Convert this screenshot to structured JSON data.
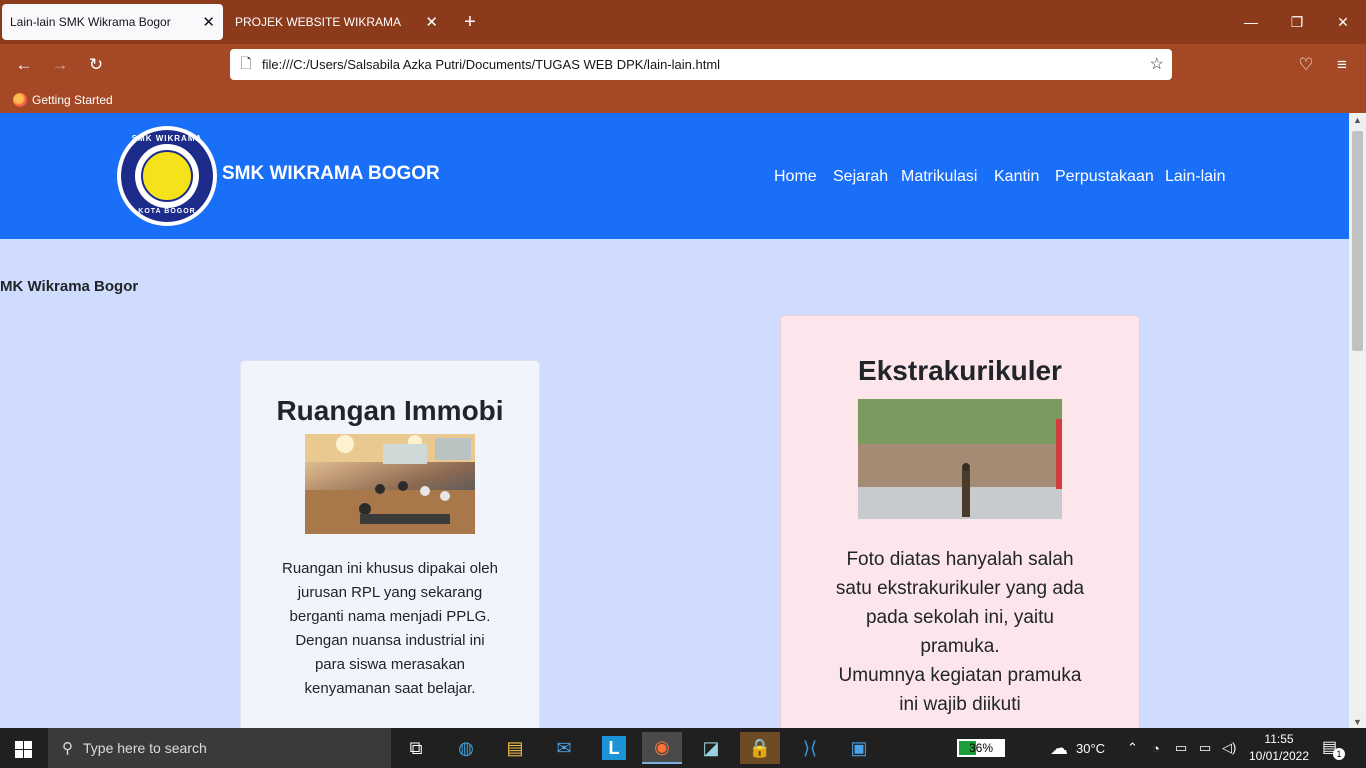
{
  "browser": {
    "tabs": [
      {
        "title": "Lain-lain SMK Wikrama Bogor",
        "active": true
      },
      {
        "title": "PROJEK WEBSITE WIKRAMA",
        "active": false
      }
    ],
    "url": "file:///C:/Users/Salsabila Azka Putri/Documents/TUGAS WEB DPK/lain-lain.html",
    "bookmarks": [
      "Getting Started"
    ]
  },
  "site": {
    "brand": "SMK WIKRAMA BOGOR",
    "logo_top": "SMK WIKRAMA",
    "logo_bottom": "KOTA BOGOR",
    "nav": [
      "Home",
      "Sejarah",
      "Matrikulasi",
      "Kantin",
      "Perpustakaan",
      "Lain-lain"
    ],
    "caption": "MK Wikrama Bogor",
    "cards": [
      {
        "title": "Ruangan Immobi",
        "text": "Ruangan ini khusus dipakai oleh jurusan RPL yang sekarang berganti nama menjadi PPLG.\nDengan nuansa industrial ini para siswa merasakan kenyamanan saat belajar."
      },
      {
        "title": "Ekstrakurikuler",
        "text": "Foto diatas hanyalah salah satu ekstrakurikuler yang ada pada sekolah ini, yaitu pramuka.\nUmumnya kegiatan pramuka ini wajib diikuti"
      }
    ]
  },
  "taskbar": {
    "search_placeholder": "Type here to search",
    "battery": "36%",
    "temperature": "30°C",
    "time": "11:55",
    "date": "10/01/2022",
    "notifications": "1"
  }
}
